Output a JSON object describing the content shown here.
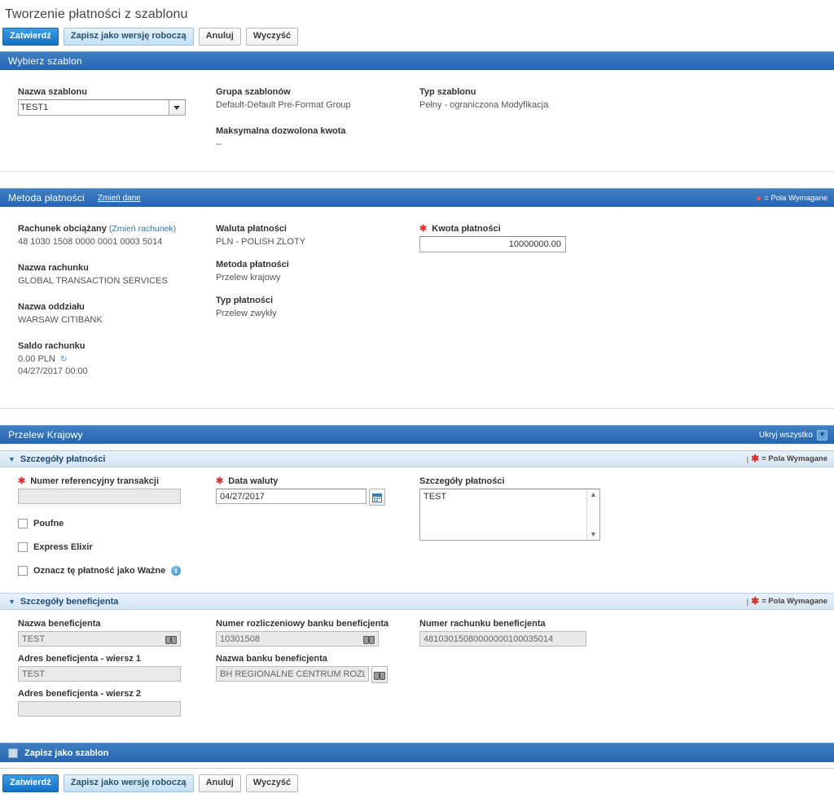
{
  "page": {
    "title": "Tworzenie płatności z szablonu"
  },
  "actions": {
    "submit": "Zatwierdź",
    "save_draft": "Zapisz jako wersję roboczą",
    "cancel": "Anuluj",
    "clear": "Wyczyść"
  },
  "template_section": {
    "header": "Wybierz szablon",
    "name_label": "Nazwa szablonu",
    "name_value": "TEST1",
    "name_options": [
      "TEST1"
    ],
    "group_label": "Grupa szablonów",
    "group_value": "Default-Default Pre-Format Group",
    "type_label": "Typ szablonu",
    "type_value": "Pełny - ograniczona Modyfikacja",
    "max_amount_label": "Maksymalna dozwolona kwota",
    "max_amount_value": "--"
  },
  "payment_method": {
    "header": "Metoda płatności",
    "change_link": "Zmień dane",
    "required_note": "= Pola Wymagane",
    "debit_account_label": "Rachunek obciążany",
    "debit_account_link": "(Zmień rachunek)",
    "debit_account_value": "48 1030 1508 0000 0001 0003 5014",
    "account_name_label": "Nazwa rachunku",
    "account_name_value": "GLOBAL TRANSACTION SERVICES",
    "branch_label": "Nazwa oddziału",
    "branch_value": "WARSAW CITIBANK",
    "balance_label": "Saldo rachunku",
    "balance_value": "0.00 PLN",
    "balance_timestamp": "04/27/2017 00:00",
    "currency_label": "Waluta płatności",
    "currency_value": "PLN - POLISH ZLOTY",
    "method_label": "Metoda płatności",
    "method_value": "Przelew krajowy",
    "type_label": "Typ płatności",
    "type_value": "Przelew zwykły",
    "amount_label": "Kwota płatności",
    "amount_value": "10000000.00"
  },
  "transfer_section": {
    "header": "Przelew Krajowy",
    "hide_all": "Ukryj wszystko"
  },
  "payment_details": {
    "header": "Szczegóły płatności",
    "required_note": "= Pola Wymagane",
    "reference_label": "Numer referencyjny transakcji",
    "reference_value": "",
    "value_date_label": "Data waluty",
    "value_date_value": "04/27/2017",
    "details_label": "Szczegóły płatności",
    "details_value": "TEST",
    "confidential_label": "Poufne",
    "express_elixir_label": "Express Elixir",
    "mark_important_label": "Oznacz tę płatność jako Ważne"
  },
  "beneficiary_details": {
    "header": "Szczegóły beneficjenta",
    "required_note": "= Pola Wymagane",
    "name_label": "Nazwa beneficjenta",
    "name_value": "TEST",
    "address1_label": "Adres beneficjenta - wiersz 1",
    "address1_value": "TEST",
    "address2_label": "Adres beneficjenta - wiersz 2",
    "address2_value": "",
    "bank_code_label": "Numer rozliczeniowy banku beneficjenta",
    "bank_code_value": "10301508",
    "bank_name_label": "Nazwa banku beneficjenta",
    "bank_name_value": "BH REGIONALNE CENTRUM ROZLICZEŃ",
    "account_label": "Numer rachunku beneficjenta",
    "account_value": "48103015080000000100035014"
  },
  "footer": {
    "save_as_template_label": "Zapisz jako szablon"
  },
  "colors": {
    "header_blue": "#2e70b8",
    "primary_button": "#1a7fd4",
    "sub_header_blue": "#dfeaf6",
    "required_red": "#d33333",
    "link_blue": "#3276b1"
  }
}
